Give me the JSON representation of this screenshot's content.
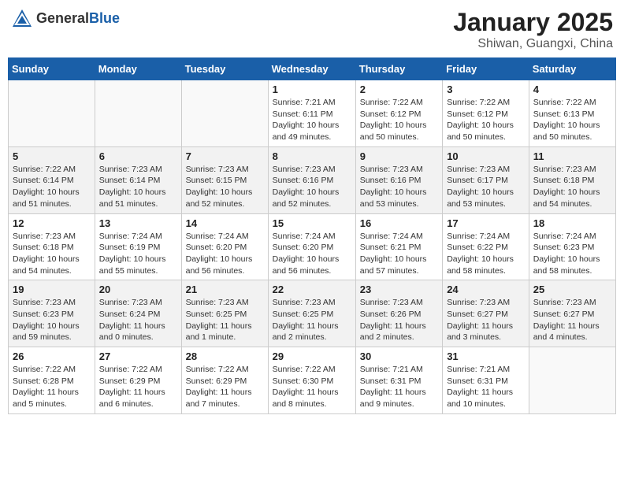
{
  "header": {
    "logo_general": "General",
    "logo_blue": "Blue",
    "title": "January 2025",
    "subtitle": "Shiwan, Guangxi, China"
  },
  "weekdays": [
    "Sunday",
    "Monday",
    "Tuesday",
    "Wednesday",
    "Thursday",
    "Friday",
    "Saturday"
  ],
  "weeks": [
    [
      {
        "day": "",
        "info": ""
      },
      {
        "day": "",
        "info": ""
      },
      {
        "day": "",
        "info": ""
      },
      {
        "day": "1",
        "info": "Sunrise: 7:21 AM\nSunset: 6:11 PM\nDaylight: 10 hours\nand 49 minutes."
      },
      {
        "day": "2",
        "info": "Sunrise: 7:22 AM\nSunset: 6:12 PM\nDaylight: 10 hours\nand 50 minutes."
      },
      {
        "day": "3",
        "info": "Sunrise: 7:22 AM\nSunset: 6:12 PM\nDaylight: 10 hours\nand 50 minutes."
      },
      {
        "day": "4",
        "info": "Sunrise: 7:22 AM\nSunset: 6:13 PM\nDaylight: 10 hours\nand 50 minutes."
      }
    ],
    [
      {
        "day": "5",
        "info": "Sunrise: 7:22 AM\nSunset: 6:14 PM\nDaylight: 10 hours\nand 51 minutes."
      },
      {
        "day": "6",
        "info": "Sunrise: 7:23 AM\nSunset: 6:14 PM\nDaylight: 10 hours\nand 51 minutes."
      },
      {
        "day": "7",
        "info": "Sunrise: 7:23 AM\nSunset: 6:15 PM\nDaylight: 10 hours\nand 52 minutes."
      },
      {
        "day": "8",
        "info": "Sunrise: 7:23 AM\nSunset: 6:16 PM\nDaylight: 10 hours\nand 52 minutes."
      },
      {
        "day": "9",
        "info": "Sunrise: 7:23 AM\nSunset: 6:16 PM\nDaylight: 10 hours\nand 53 minutes."
      },
      {
        "day": "10",
        "info": "Sunrise: 7:23 AM\nSunset: 6:17 PM\nDaylight: 10 hours\nand 53 minutes."
      },
      {
        "day": "11",
        "info": "Sunrise: 7:23 AM\nSunset: 6:18 PM\nDaylight: 10 hours\nand 54 minutes."
      }
    ],
    [
      {
        "day": "12",
        "info": "Sunrise: 7:23 AM\nSunset: 6:18 PM\nDaylight: 10 hours\nand 54 minutes."
      },
      {
        "day": "13",
        "info": "Sunrise: 7:24 AM\nSunset: 6:19 PM\nDaylight: 10 hours\nand 55 minutes."
      },
      {
        "day": "14",
        "info": "Sunrise: 7:24 AM\nSunset: 6:20 PM\nDaylight: 10 hours\nand 56 minutes."
      },
      {
        "day": "15",
        "info": "Sunrise: 7:24 AM\nSunset: 6:20 PM\nDaylight: 10 hours\nand 56 minutes."
      },
      {
        "day": "16",
        "info": "Sunrise: 7:24 AM\nSunset: 6:21 PM\nDaylight: 10 hours\nand 57 minutes."
      },
      {
        "day": "17",
        "info": "Sunrise: 7:24 AM\nSunset: 6:22 PM\nDaylight: 10 hours\nand 58 minutes."
      },
      {
        "day": "18",
        "info": "Sunrise: 7:24 AM\nSunset: 6:23 PM\nDaylight: 10 hours\nand 58 minutes."
      }
    ],
    [
      {
        "day": "19",
        "info": "Sunrise: 7:23 AM\nSunset: 6:23 PM\nDaylight: 10 hours\nand 59 minutes."
      },
      {
        "day": "20",
        "info": "Sunrise: 7:23 AM\nSunset: 6:24 PM\nDaylight: 11 hours\nand 0 minutes."
      },
      {
        "day": "21",
        "info": "Sunrise: 7:23 AM\nSunset: 6:25 PM\nDaylight: 11 hours\nand 1 minute."
      },
      {
        "day": "22",
        "info": "Sunrise: 7:23 AM\nSunset: 6:25 PM\nDaylight: 11 hours\nand 2 minutes."
      },
      {
        "day": "23",
        "info": "Sunrise: 7:23 AM\nSunset: 6:26 PM\nDaylight: 11 hours\nand 2 minutes."
      },
      {
        "day": "24",
        "info": "Sunrise: 7:23 AM\nSunset: 6:27 PM\nDaylight: 11 hours\nand 3 minutes."
      },
      {
        "day": "25",
        "info": "Sunrise: 7:23 AM\nSunset: 6:27 PM\nDaylight: 11 hours\nand 4 minutes."
      }
    ],
    [
      {
        "day": "26",
        "info": "Sunrise: 7:22 AM\nSunset: 6:28 PM\nDaylight: 11 hours\nand 5 minutes."
      },
      {
        "day": "27",
        "info": "Sunrise: 7:22 AM\nSunset: 6:29 PM\nDaylight: 11 hours\nand 6 minutes."
      },
      {
        "day": "28",
        "info": "Sunrise: 7:22 AM\nSunset: 6:29 PM\nDaylight: 11 hours\nand 7 minutes."
      },
      {
        "day": "29",
        "info": "Sunrise: 7:22 AM\nSunset: 6:30 PM\nDaylight: 11 hours\nand 8 minutes."
      },
      {
        "day": "30",
        "info": "Sunrise: 7:21 AM\nSunset: 6:31 PM\nDaylight: 11 hours\nand 9 minutes."
      },
      {
        "day": "31",
        "info": "Sunrise: 7:21 AM\nSunset: 6:31 PM\nDaylight: 11 hours\nand 10 minutes."
      },
      {
        "day": "",
        "info": ""
      }
    ]
  ]
}
